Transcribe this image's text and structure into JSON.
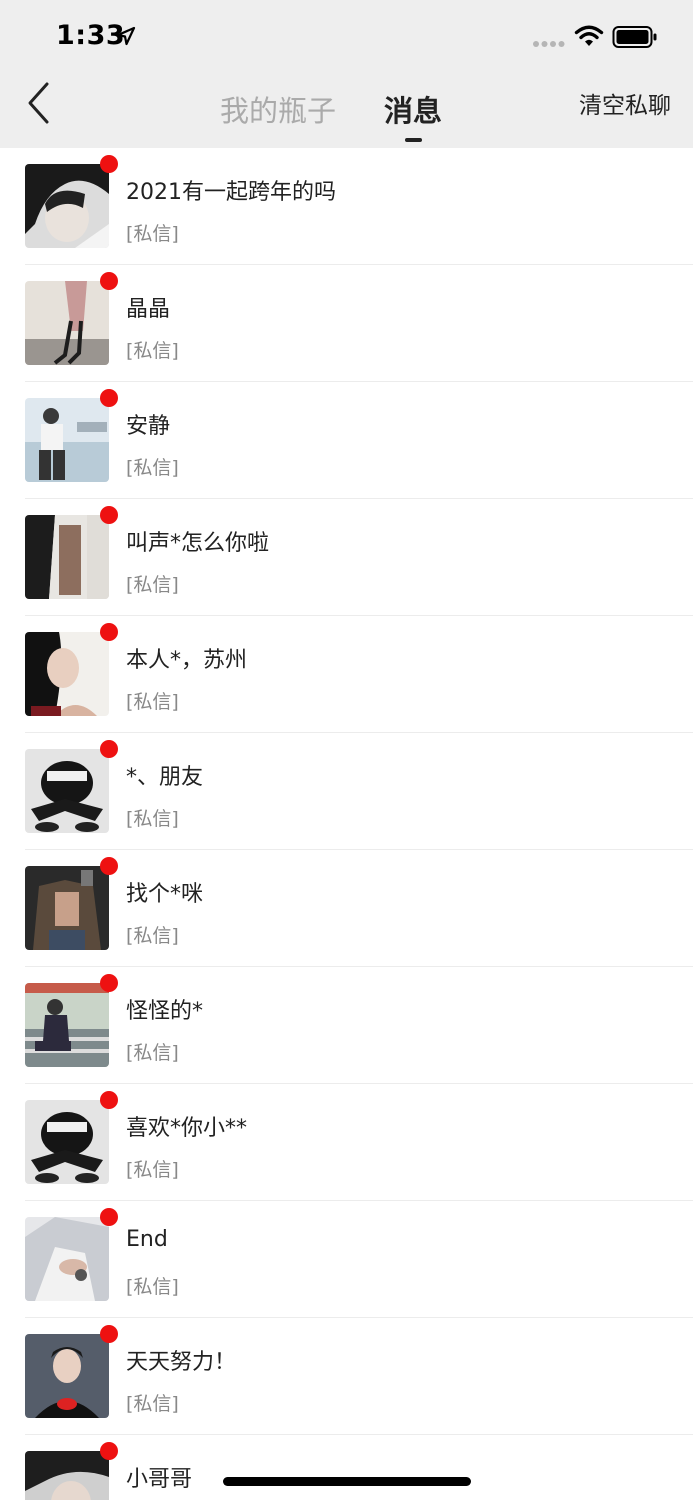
{
  "status_bar": {
    "time": "1:33",
    "icons": [
      "location-arrow-icon",
      "signal-icon",
      "wifi-icon",
      "battery-icon"
    ]
  },
  "nav": {
    "back_icon": "chevron-left-icon",
    "tabs": [
      {
        "label": "我的瓶子",
        "active": false
      },
      {
        "label": "消息",
        "active": true
      }
    ],
    "clear_label": "清空私聊"
  },
  "colors": {
    "accent_dot": "#ee1111",
    "header_bg": "#eeeeee",
    "active_tab": "#222222",
    "inactive_tab": "#aaaaaa"
  },
  "messages": [
    {
      "title": "2021有一起跨年的吗",
      "subtitle": "[私信]",
      "unread": true
    },
    {
      "title": "晶晶",
      "subtitle": "[私信]",
      "unread": true
    },
    {
      "title": "安静",
      "subtitle": "[私信]",
      "unread": true
    },
    {
      "title": "叫声*怎么你啦",
      "subtitle": "[私信]",
      "unread": true
    },
    {
      "title": "本人*，苏州",
      "subtitle": "[私信]",
      "unread": true
    },
    {
      "title": "*、朋友",
      "subtitle": "[私信]",
      "unread": true
    },
    {
      "title": "找个*咪",
      "subtitle": "[私信]",
      "unread": true
    },
    {
      "title": "怪怪的*",
      "subtitle": "[私信]",
      "unread": true
    },
    {
      "title": "喜欢*你小**",
      "subtitle": "[私信]",
      "unread": true
    },
    {
      "title": "End",
      "subtitle": "[私信]",
      "unread": true
    },
    {
      "title": "天天努力！",
      "subtitle": "[私信]",
      "unread": true
    },
    {
      "title": "小哥哥",
      "subtitle": "",
      "unread": true
    }
  ]
}
